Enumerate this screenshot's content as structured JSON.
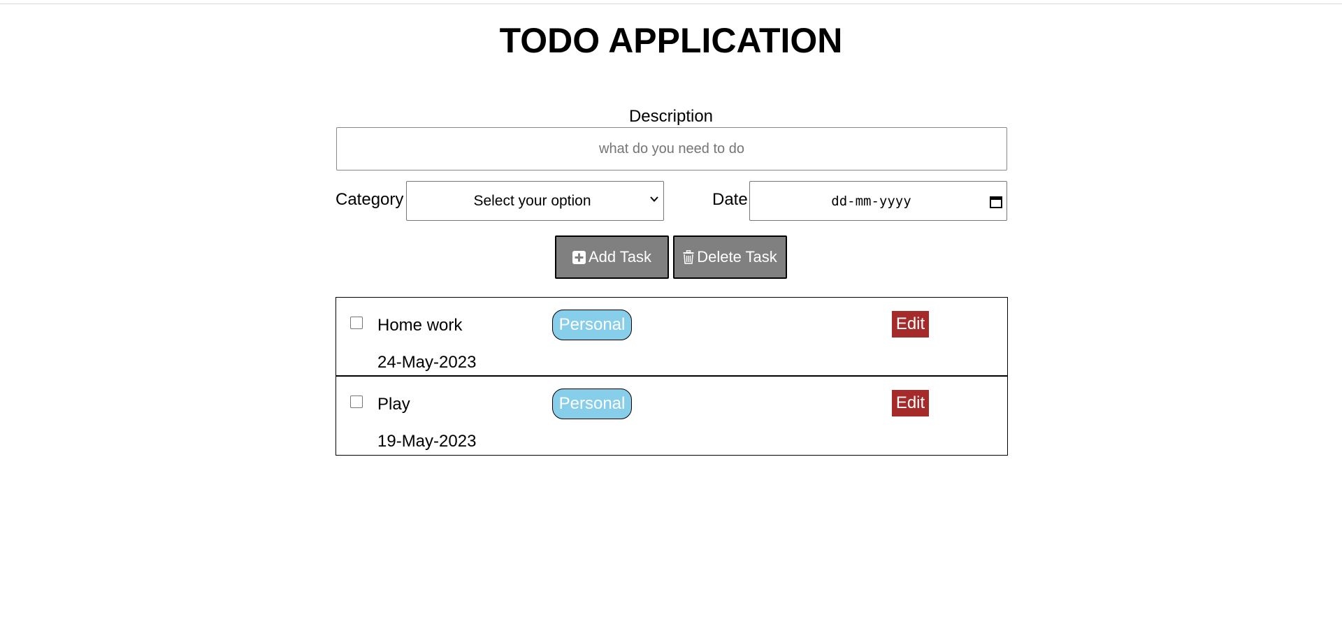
{
  "app": {
    "title": "TODO APPLICATION"
  },
  "form": {
    "description_label": "Description",
    "description_placeholder": "what do you need to do",
    "description_value": "",
    "category_label": "Category",
    "category_selected": "Select your option",
    "date_label": "Date",
    "date_placeholder": "dd-mm-yyyy"
  },
  "actions": {
    "add_label": "Add Task",
    "add_icon": "plus-square-icon",
    "delete_label": "Delete Task",
    "delete_icon": "trash-icon"
  },
  "tasks": [
    {
      "description": "Home work",
      "category": "Personal",
      "date": "24-May-2023",
      "checked": false,
      "edit_label": "Edit"
    },
    {
      "description": "Play",
      "category": "Personal",
      "date": "19-May-2023",
      "checked": false,
      "edit_label": "Edit"
    }
  ],
  "colors": {
    "button_bg": "#808080",
    "badge_bg": "#87ceeb",
    "edit_bg": "#a52a2a"
  }
}
